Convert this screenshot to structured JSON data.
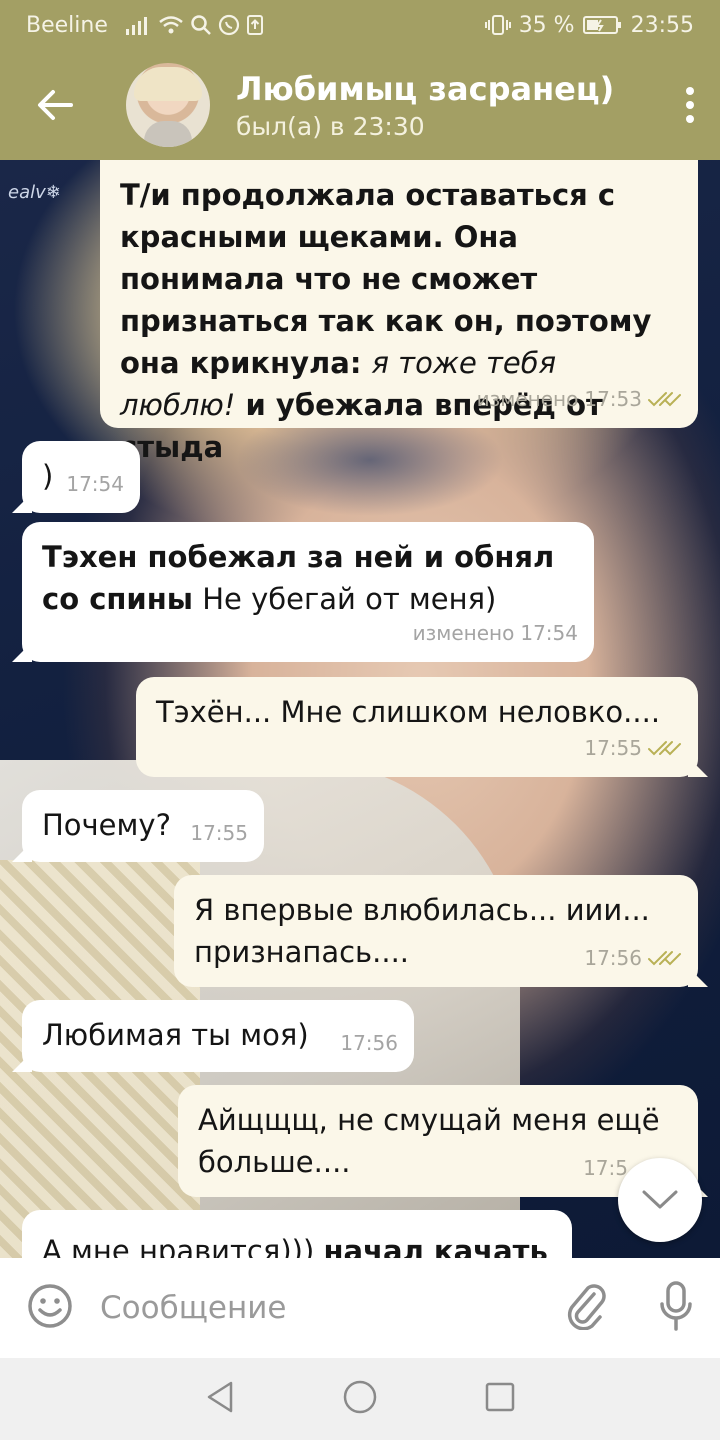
{
  "status_bar": {
    "carrier": "Beeline",
    "battery": "35 %",
    "time": "23:55"
  },
  "header": {
    "back_icon": "arrow-left-icon",
    "title": "Любимыц засранец)",
    "subtitle": "был(а) в 23:30",
    "menu_icon": "vertical-dots-icon"
  },
  "chat": {
    "watermark": "ealv❄",
    "messages": [
      {
        "dir": "out",
        "time": "17:53",
        "status": "изменено",
        "read": true
      },
      {
        "dir": "in",
        "text": ")",
        "time": "17:54"
      },
      {
        "dir": "in",
        "time": "17:54",
        "status": "изменено"
      },
      {
        "dir": "out",
        "text": "Тэхён... Мне слишком неловко....",
        "time": "17:55",
        "read": true
      },
      {
        "dir": "in",
        "text": "Почему?",
        "time": "17:55"
      },
      {
        "dir": "out",
        "text": "Я впервые влюбилась... иии... признапась....",
        "time": "17:56",
        "read": true
      },
      {
        "dir": "in",
        "text": "Любимая ты моя)",
        "time": "17:56"
      },
      {
        "dir": "out",
        "text": "Айщщщ, не смущай меня ещё больше....",
        "time": "17:5"
      },
      {
        "dir": "in"
      }
    ],
    "m1": {
      "p1": "Т/и продолжала оставаться с красными щеками. Она понимала что не сможет признаться так как он, поэтому она крикнула: ",
      "p2": "я тоже тебя люблю!",
      "p3": " и убежала вперёд от стыда"
    },
    "m3": {
      "p1": "Тэхен побежал за ней и обнял со спины",
      "p2": " Не убегай от меня)"
    },
    "m9": {
      "p1": "А мне нравится))) ",
      "p2": "начал качать"
    }
  },
  "composer": {
    "placeholder": "Сообщение",
    "emoji_icon": "smile-icon",
    "attach_icon": "paperclip-icon",
    "mic_icon": "microphone-icon"
  },
  "nav": {
    "back": "triangle-back-icon",
    "home": "circle-home-icon",
    "recents": "square-recents-icon"
  },
  "colors": {
    "header": "#a39f64",
    "outgoing_bubble": "#fbf7e9",
    "incoming_bubble": "#ffffff",
    "check": "#b9b156"
  }
}
